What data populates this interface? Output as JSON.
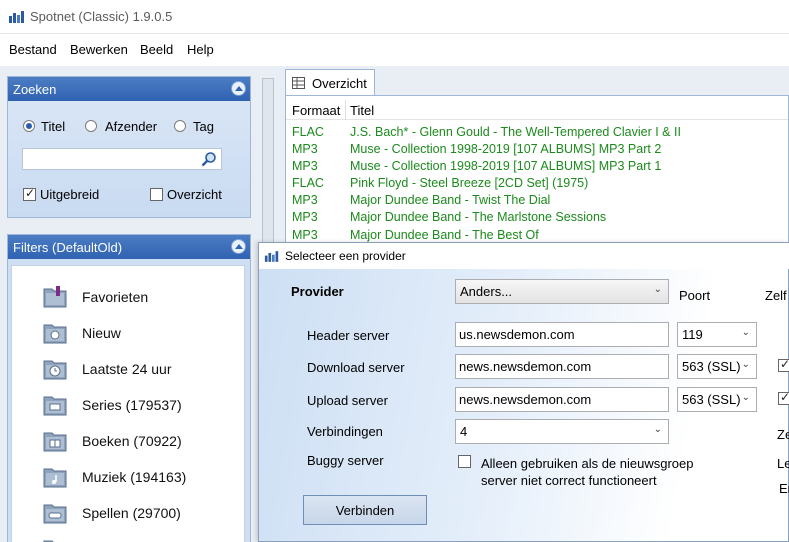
{
  "window": {
    "title": "Spotnet (Classic) 1.9.0.5"
  },
  "menu": [
    "Bestand",
    "Bewerken",
    "Beeld",
    "Help"
  ],
  "search_panel": {
    "title": "Zoeken",
    "options": [
      "Titel",
      "Afzender",
      "Tag"
    ],
    "selected": "Titel",
    "query": "",
    "checkboxes": [
      {
        "label": "Uitgebreid",
        "checked": true
      },
      {
        "label": "Overzicht",
        "checked": false
      }
    ]
  },
  "filters_panel": {
    "title": "Filters (DefaultOld)",
    "items": [
      {
        "label": "Favorieten",
        "icon": "favorites-folder-icon"
      },
      {
        "label": "Nieuw",
        "icon": "info-folder-icon"
      },
      {
        "label": "Laatste 24 uur",
        "icon": "clock-folder-icon"
      },
      {
        "label": "Series (179537)",
        "icon": "series-folder-icon"
      },
      {
        "label": "Boeken (70922)",
        "icon": "books-folder-icon"
      },
      {
        "label": "Muziek (194163)",
        "icon": "music-folder-icon"
      },
      {
        "label": "Spellen (29700)",
        "icon": "games-folder-icon"
      }
    ]
  },
  "overview": {
    "tab_label": "Overzicht",
    "columns": [
      "Formaat",
      "Titel"
    ],
    "rows": [
      {
        "format": "FLAC",
        "title": "J.S. Bach* - Glenn Gould - The Well-Tempered Clavier I & II"
      },
      {
        "format": "MP3",
        "title": "Muse - Collection 1998-2019 [107 ALBUMS] MP3 Part 2"
      },
      {
        "format": "MP3",
        "title": "Muse - Collection 1998-2019 [107 ALBUMS] MP3 Part 1"
      },
      {
        "format": "FLAC",
        "title": "Pink Floyd - Steel Breeze [2CD Set] (1975)"
      },
      {
        "format": "MP3",
        "title": "Major Dundee Band - Twist The Dial"
      },
      {
        "format": "MP3",
        "title": "Major Dundee Band - The Marlstone Sessions"
      },
      {
        "format": "MP3",
        "title": "Major Dundee Band - The Best Of"
      }
    ]
  },
  "dialog": {
    "title": "Selecteer een provider",
    "provider_label": "Provider",
    "provider_value": "Anders...",
    "port_label": "Poort",
    "zelf_label": "Zelf",
    "header_server_label": "Header server",
    "header_server_value": "us.newsdemon.com",
    "header_port": "119",
    "download_server_label": "Download server",
    "download_server_value": "news.newsdemon.com",
    "download_port": "563 (SSL)",
    "upload_server_label": "Upload server",
    "upload_server_value": "news.newsdemon.com",
    "upload_port": "563 (SSL)",
    "connections_label": "Verbindingen",
    "connections_value": "4",
    "buggy_label": "Buggy server",
    "buggy_checkbox_line1": "Alleen gebruiken als de nieuwsgroep",
    "buggy_checkbox_line2": "server niet correct functioneert",
    "cut_labels": [
      "Ze",
      "Le",
      "Er"
    ],
    "connect_button": "Verbinden"
  }
}
